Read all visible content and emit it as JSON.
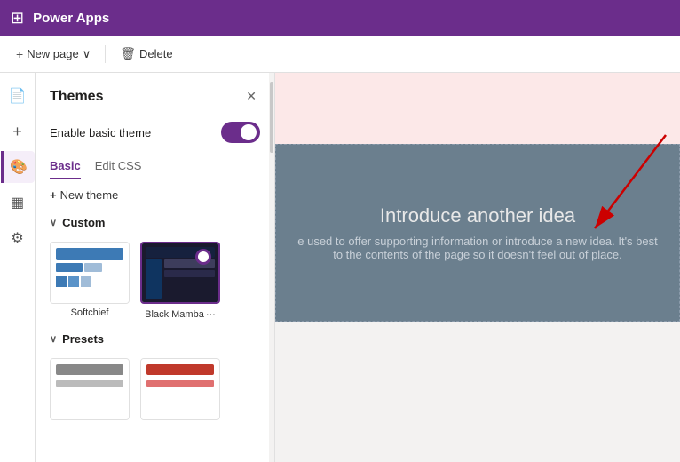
{
  "topnav": {
    "title": "Power Apps",
    "grid_icon": "⊞"
  },
  "toolbar": {
    "new_page_label": "New page",
    "chevron": "∨",
    "delete_label": "Delete",
    "plus_icon": "+",
    "trash_icon": "🗑"
  },
  "sidebar": {
    "icons": [
      {
        "name": "page-icon",
        "symbol": "⬜",
        "active": false
      },
      {
        "name": "plus-icon",
        "symbol": "+",
        "active": false
      },
      {
        "name": "brush-icon",
        "symbol": "🎨",
        "active": true
      },
      {
        "name": "table-icon",
        "symbol": "⊞",
        "active": false
      },
      {
        "name": "gear-icon",
        "symbol": "⚙",
        "active": false
      }
    ]
  },
  "themes_panel": {
    "title": "Themes",
    "close_label": "✕",
    "enable_label": "Enable basic theme",
    "toggle_on": true,
    "tab_basic": "Basic",
    "tab_edit_css": "Edit CSS",
    "new_theme_label": "New theme",
    "custom_section": "Custom",
    "presets_section": "Presets",
    "themes": [
      {
        "id": "softchief",
        "name": "Softchief",
        "selected": false
      },
      {
        "id": "blackmamba",
        "name": "Black Mamba",
        "selected": true,
        "more": "···"
      }
    ]
  },
  "main_content": {
    "heading": "Introduce another idea",
    "body_text": "e used to offer supporting information or introduce a new idea. It's best to the contents of the page so it doesn't feel out of place."
  }
}
